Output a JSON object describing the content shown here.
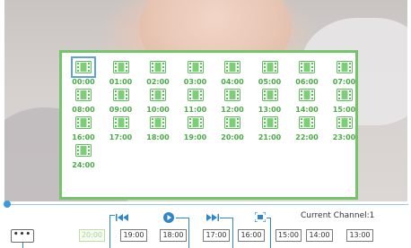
{
  "grid": {
    "items": [
      {
        "label": "00:00",
        "selected": true
      },
      {
        "label": "01:00"
      },
      {
        "label": "02:00"
      },
      {
        "label": "03:00"
      },
      {
        "label": "04:00"
      },
      {
        "label": "05:00"
      },
      {
        "label": "06:00"
      },
      {
        "label": "07:00"
      },
      {
        "label": "08:00"
      },
      {
        "label": "09:00"
      },
      {
        "label": "10:00"
      },
      {
        "label": "11:00"
      },
      {
        "label": "12:00"
      },
      {
        "label": "13:00"
      },
      {
        "label": "14:00"
      },
      {
        "label": "15:00"
      },
      {
        "label": "16:00"
      },
      {
        "label": "17:00"
      },
      {
        "label": "18:00"
      },
      {
        "label": "19:00"
      },
      {
        "label": "20:00"
      },
      {
        "label": "21:00"
      },
      {
        "label": "22:00"
      },
      {
        "label": "23:00"
      },
      {
        "label": "24:00"
      }
    ],
    "icon": "film-clip-icon",
    "accent_color": "#74c46a"
  },
  "controls": {
    "more_label": "•••",
    "channel_label": "Current Channel:1",
    "icons": [
      "skip-to-start-icon",
      "play-icon",
      "skip-to-end-icon",
      "fullscreen-icon"
    ],
    "accent_color": "#2f86c8"
  },
  "time_buttons": [
    {
      "label": "20:00",
      "active": true
    },
    {
      "label": "19:00"
    },
    {
      "label": "18:00"
    },
    {
      "label": "17:00"
    },
    {
      "label": "16:00"
    },
    {
      "label": "15:00"
    },
    {
      "label": "14:00"
    },
    {
      "label": "13:00"
    }
  ]
}
